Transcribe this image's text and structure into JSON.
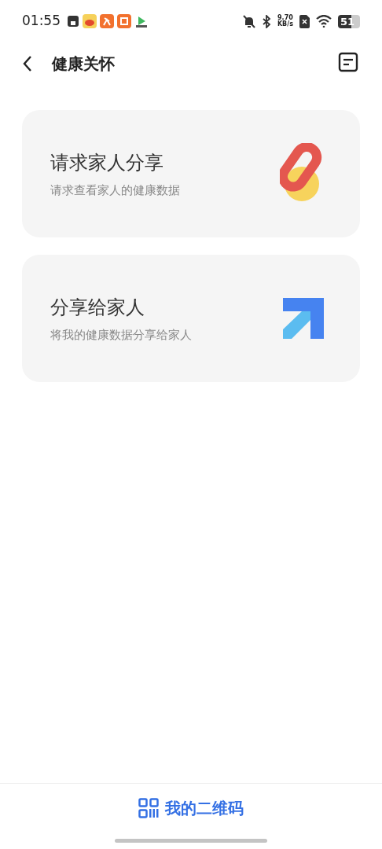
{
  "status_bar": {
    "time": "01:55",
    "net_speed": "9.70",
    "net_unit": "KB/s",
    "battery": "51"
  },
  "header": {
    "title": "健康关怀"
  },
  "cards": [
    {
      "kind": "link",
      "title": "请求家人分享",
      "subtitle": "请求查看家人的健康数据"
    },
    {
      "kind": "arrow",
      "title": "分享给家人",
      "subtitle": "将我的健康数据分享给家人"
    }
  ],
  "footer": {
    "label": "我的二维码"
  }
}
